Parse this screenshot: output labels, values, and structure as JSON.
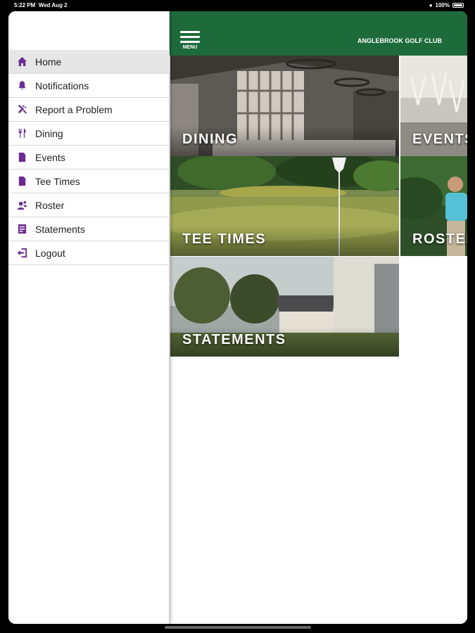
{
  "status": {
    "time": "5:22 PM",
    "date": "Wed Aug 2",
    "battery": "100%"
  },
  "header": {
    "menu_label": "MENU",
    "club_name": "ANGLEBROOK GOLF CLUB"
  },
  "sidebar": {
    "items": [
      {
        "label": "Home",
        "icon": "home-icon",
        "active": true
      },
      {
        "label": "Notifications",
        "icon": "bell-icon"
      },
      {
        "label": "Report a Problem",
        "icon": "tools-icon"
      },
      {
        "label": "Dining",
        "icon": "utensils-icon"
      },
      {
        "label": "Events",
        "icon": "document-icon"
      },
      {
        "label": "Tee Times",
        "icon": "document-icon"
      },
      {
        "label": "Roster",
        "icon": "people-icon"
      },
      {
        "label": "Statements",
        "icon": "statement-icon"
      },
      {
        "label": "Logout",
        "icon": "logout-icon"
      }
    ]
  },
  "tiles": {
    "dining": "DINING",
    "events": "EVENTS",
    "tee_times": "TEE TIMES",
    "roster": "ROSTER",
    "statements": "STATEMENTS"
  },
  "colors": {
    "header_green": "#1d6b3a",
    "icon_purple": "#6b2c91"
  }
}
